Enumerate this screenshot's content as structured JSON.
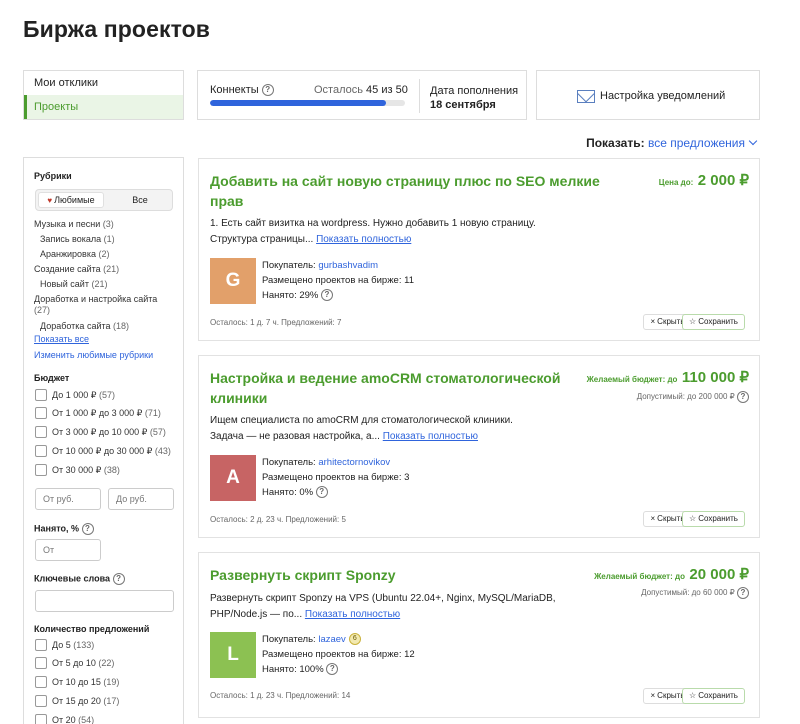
{
  "page": {
    "title": "Биржа проектов"
  },
  "nav": {
    "items": [
      {
        "label": "Мои отклики"
      },
      {
        "label": "Проекты"
      }
    ]
  },
  "connects": {
    "label": "Коннекты",
    "left_label": "Осталось",
    "left_value": "45 из 50",
    "progress_fraction": 0.9,
    "refill_label": "Дата пополнения",
    "refill_date": "18 сентября"
  },
  "notifications": {
    "label": "Настройка уведомлений"
  },
  "show": {
    "label": "Показать:",
    "value": "все предложения"
  },
  "filters": {
    "rubrics_title": "Рубрики",
    "seg_favorites": "Любимые",
    "seg_all": "Все",
    "rubrics": [
      {
        "label": "Музыка и песни",
        "count": "(3)"
      },
      {
        "label": "Запись вокала",
        "count": "(1)"
      },
      {
        "label": "Аранжировка",
        "count": "(2)"
      },
      {
        "label": "Создание сайта",
        "count": "(21)"
      },
      {
        "label": "Новый сайт",
        "count": "(21)"
      },
      {
        "label": "Доработка и настройка сайта",
        "count": "(27)"
      },
      {
        "label": "Доработка сайта",
        "count": "(18)"
      }
    ],
    "show_all": "Показать все",
    "edit_favorites": "Изменить любимые рубрики",
    "budget_title": "Бюджет",
    "budget_options": [
      {
        "label": "До 1 000 ₽",
        "count": "(57)"
      },
      {
        "label": "От 1 000 ₽ до 3 000 ₽",
        "count": "(71)"
      },
      {
        "label": "От 3 000 ₽ до 10 000 ₽",
        "count": "(57)"
      },
      {
        "label": "От 10 000 ₽ до 30 000 ₽",
        "count": "(43)"
      },
      {
        "label": "От 30 000 ₽",
        "count": "(38)"
      }
    ],
    "budget_from_placeholder": "От руб.",
    "budget_to_placeholder": "До руб.",
    "hired_title": "Нанято, %",
    "hired_placeholder": "От",
    "keywords_title": "Ключевые слова",
    "offers_title": "Количество предложений",
    "offers_options": [
      {
        "label": "До 5",
        "count": "(133)"
      },
      {
        "label": "От 5 до 10",
        "count": "(22)"
      },
      {
        "label": "От 10 до 15",
        "count": "(19)"
      },
      {
        "label": "От 15 до 20",
        "count": "(17)"
      },
      {
        "label": "От 20",
        "count": "(54)"
      }
    ]
  },
  "projects": [
    {
      "title": "Добавить на сайт новую страницу плюс по SEO мелкие прав",
      "price_label": "Цена до:",
      "price": "2 000 ₽",
      "allowed": "",
      "desc_line1": "1. Есть сайт визитка на wordpress. Нужно добавить 1 новую страницу.",
      "desc_line2": "Структура страницы...",
      "show_full": "Показать полностью",
      "avatar_letter": "G",
      "avatar_color": "#e2a06a",
      "buyer_label": "Покупатель:",
      "buyer": "gurbashvadim",
      "placed": "Размещено проектов на бирже: 11",
      "hired": "Нанято: 29%",
      "meta": "Осталось: 1 д. 7 ч.   Предложений: 7",
      "hide": "Скрыть",
      "save": "Сохранить"
    },
    {
      "title": "Настройка и ведение amoCRM стоматологической клиники",
      "price_label": "Желаемый бюджет: до",
      "price": "110 000 ₽",
      "allowed": "Допустимый: до 200 000 ₽",
      "desc_line1": "Ищем специалиста по amoCRM для стоматологической клиники.",
      "desc_line2": "Задача — не разовая настройка, а...",
      "show_full": "Показать полностью",
      "avatar_letter": "A",
      "avatar_color": "#c76464",
      "buyer_label": "Покупатель:",
      "buyer": "arhitectornovikov",
      "placed": "Размещено проектов на бирже: 3",
      "hired": "Нанято: 0%",
      "meta": "Осталось: 2 д. 23 ч.   Предложений: 5",
      "hide": "Скрыть",
      "save": "Сохранить"
    },
    {
      "title": "Развернуть скрипт Sponzy",
      "price_label": "Желаемый бюджет: до",
      "price": "20 000 ₽",
      "allowed": "Допустимый: до 60 000 ₽",
      "desc_line1": "Развернуть скрипт Sponzy на VPS (Ubuntu 22.04+, Nginx, MySQL/MariaDB,",
      "desc_line2": "PHP/Node.js — по...",
      "show_full": "Показать полностью",
      "avatar_letter": "L",
      "avatar_color": "#8cc152",
      "buyer_label": "Покупатель:",
      "buyer": "lazaev",
      "badge": "6",
      "placed": "Размещено проектов на бирже: 12",
      "hired": "Нанято: 100%",
      "meta": "Осталось: 1 д. 23 ч.   Предложений: 14",
      "hide": "Скрыть",
      "save": "Сохранить"
    }
  ]
}
